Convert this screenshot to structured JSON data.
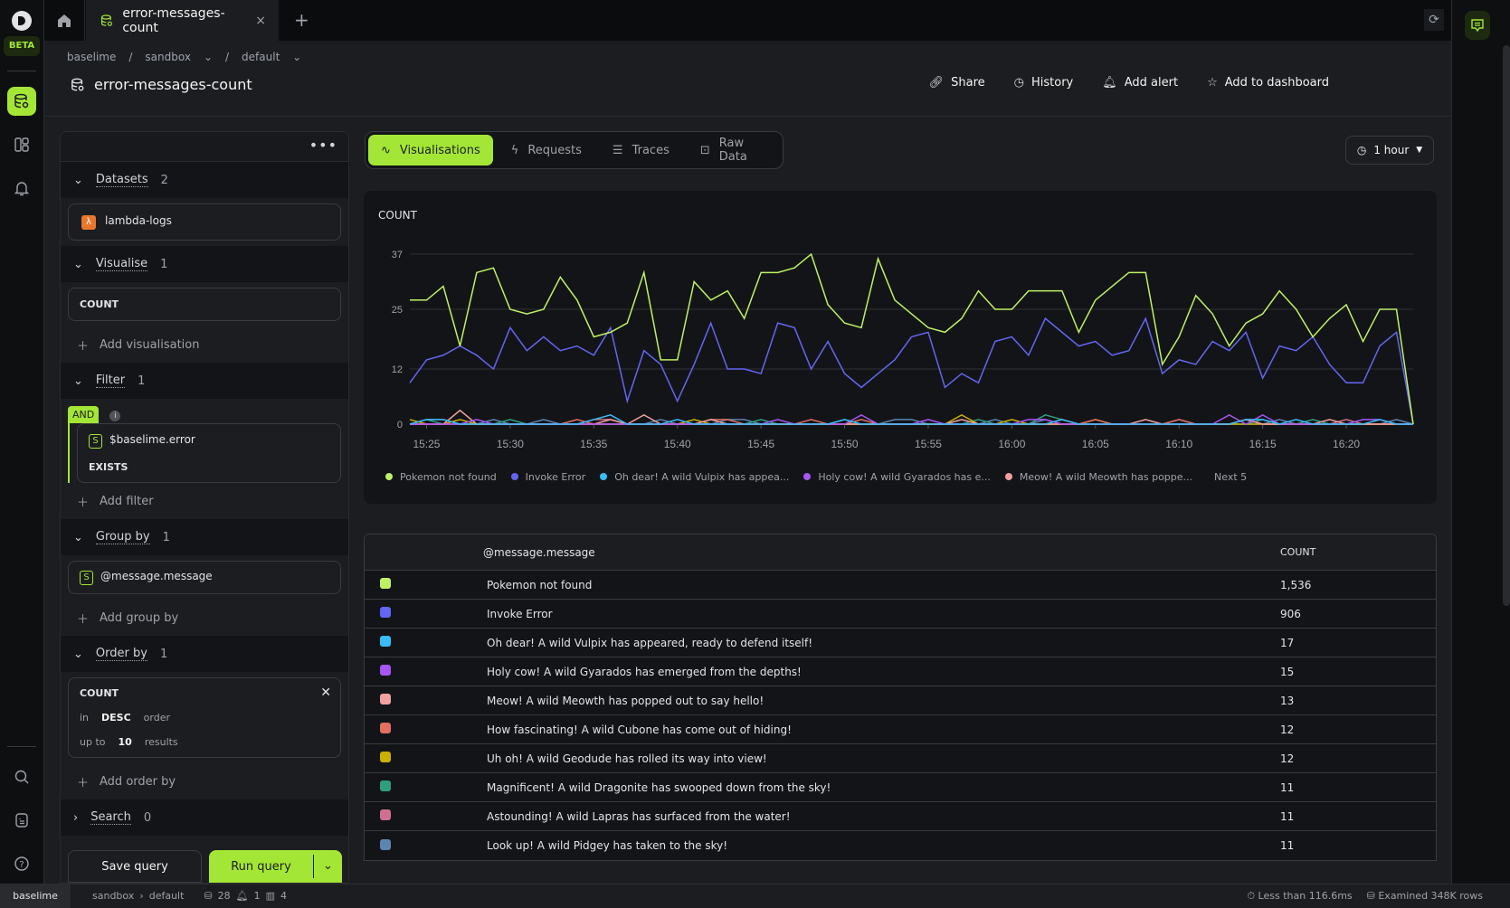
{
  "nav": {
    "beta_label": "BETA",
    "items": [
      {
        "name": "query-icon",
        "active": true
      },
      {
        "name": "dashboards-icon",
        "active": false
      },
      {
        "name": "alerts-icon",
        "active": false
      }
    ],
    "bottom_items": [
      "search-icon",
      "docs-icon",
      "help-icon"
    ]
  },
  "tabs": {
    "active_tab": "error-messages-count",
    "close_glyph": "×",
    "add_glyph": "+"
  },
  "breadcrumb": {
    "org": "baselime",
    "env": "sandbox",
    "service": "default",
    "sep": "/"
  },
  "page": {
    "title": "error-messages-count",
    "actions": {
      "share": "Share",
      "history": "History",
      "add_alert": "Add alert",
      "add_to_dashboard": "Add to dashboard"
    }
  },
  "query": {
    "datasets": {
      "label": "Datasets",
      "count": "2",
      "items": [
        "lambda-logs"
      ]
    },
    "visualise": {
      "label": "Visualise",
      "count": "1",
      "items": [
        "COUNT"
      ],
      "add": "Add visualisation"
    },
    "filter": {
      "label": "Filter",
      "count": "1",
      "operator": "AND",
      "items": [
        {
          "key": "$baselime.error",
          "op": "EXISTS"
        }
      ],
      "add": "Add filter"
    },
    "group_by": {
      "label": "Group by",
      "count": "1",
      "items": [
        "@message.message"
      ],
      "add": "Add group by"
    },
    "order_by": {
      "label": "Order by",
      "count": "1",
      "field": "COUNT",
      "in": "in",
      "direction": "DESC",
      "order": "order",
      "up_to": "up to",
      "limit": "10",
      "results": "results",
      "add": "Add order by"
    },
    "search": {
      "label": "Search",
      "count": "0"
    },
    "save": "Save query",
    "run": "Run query"
  },
  "view_tabs": {
    "visualisations": "Visualisations",
    "requests": "Requests",
    "traces": "Traces",
    "raw_data": "Raw Data"
  },
  "time_range": "1 hour",
  "chart_data": {
    "type": "line",
    "title": "COUNT",
    "xlabel": "",
    "ylabel": "",
    "ylim": [
      0,
      37
    ],
    "yticks": [
      0,
      12,
      25,
      37
    ],
    "xticks": [
      "15:25",
      "15:30",
      "15:35",
      "15:40",
      "15:45",
      "15:50",
      "15:55",
      "16:00",
      "16:05",
      "16:10",
      "16:15",
      "16:20"
    ],
    "x_start": "15:24",
    "x_step_minutes": 1,
    "grid": true,
    "legend_position": "bottom-left",
    "legend_more": "Next 5",
    "series": [
      {
        "name": "Pokemon not found",
        "legend": "Pokemon not found",
        "color": "#bef264",
        "values": [
          27,
          27,
          30,
          17,
          33,
          34,
          25,
          24,
          25,
          32,
          27,
          19,
          20,
          22,
          33,
          14,
          14,
          31,
          27,
          29,
          23,
          33,
          33,
          34,
          37,
          26,
          22,
          21,
          36,
          27,
          24,
          21,
          20,
          23,
          29,
          25,
          25,
          29,
          29,
          29,
          20,
          27,
          30,
          33,
          33,
          13,
          19,
          28,
          24,
          17,
          22,
          24,
          29,
          25,
          19,
          23,
          26,
          18,
          25,
          25,
          0
        ]
      },
      {
        "name": "Invoke Error",
        "legend": "Invoke Error",
        "color": "#6366f1",
        "values": [
          9,
          14,
          15,
          17,
          15,
          12,
          21,
          16,
          19,
          16,
          17,
          15,
          21,
          5,
          16,
          13,
          5,
          13,
          22,
          12,
          12,
          11,
          22,
          21,
          12,
          18,
          11,
          8,
          11,
          14,
          19,
          20,
          8,
          11,
          9,
          18,
          19,
          15,
          23,
          20,
          17,
          18,
          15,
          16,
          23,
          11,
          14,
          13,
          18,
          16,
          20,
          10,
          17,
          16,
          19,
          13,
          9,
          9,
          17,
          20,
          0
        ]
      },
      {
        "name": "Oh dear! A wild Vulpix has appeared, ready to defend itself!",
        "legend": "Oh dear! A wild Vulpix has appea...",
        "color": "#38bdf8",
        "values": [
          0,
          1,
          1,
          0,
          0,
          0,
          0,
          0,
          0,
          0,
          0,
          1,
          2,
          0,
          0,
          0,
          1,
          0,
          0,
          0,
          0,
          0,
          0,
          0,
          0,
          0,
          1,
          0,
          0,
          0,
          0,
          0,
          0,
          0,
          0,
          0,
          0,
          0,
          0,
          1,
          0,
          0,
          0,
          0,
          0,
          0,
          0,
          0,
          0,
          0,
          1,
          1,
          0,
          1,
          0,
          0,
          0,
          0,
          1,
          0,
          0
        ]
      },
      {
        "name": "Holy cow! A wild Gyarados has emerged from the depths!",
        "legend": "Holy cow! A wild Gyarados has e...",
        "color": "#a855f7",
        "values": [
          0,
          0,
          0,
          0,
          1,
          0,
          0,
          0,
          0,
          0,
          0,
          0,
          0,
          0,
          0,
          0,
          0,
          0,
          0,
          0,
          0,
          0,
          1,
          0,
          0,
          0,
          0,
          2,
          0,
          0,
          0,
          1,
          0,
          0,
          0,
          0,
          0,
          1,
          1,
          0,
          0,
          0,
          0,
          0,
          0,
          0,
          0,
          0,
          0,
          2,
          0,
          2,
          0,
          0,
          0,
          0,
          0,
          1,
          1,
          0,
          0
        ]
      },
      {
        "name": "Meow! A wild Meowth has popped out to say hello!",
        "legend": "Meow! A wild Meowth has poppe...",
        "color": "#f0a0a0",
        "values": [
          0,
          0,
          0,
          3,
          0,
          0,
          0,
          0,
          0,
          0,
          0,
          0,
          1,
          0,
          2,
          0,
          0,
          0,
          1,
          0,
          0,
          0,
          0,
          0,
          0,
          0,
          0,
          0,
          0,
          0,
          0,
          0,
          0,
          1,
          0,
          0,
          0,
          0,
          0,
          0,
          0,
          0,
          0,
          0,
          1,
          0,
          0,
          0,
          0,
          0,
          1,
          0,
          0,
          0,
          0,
          1,
          0,
          0,
          0,
          0,
          0
        ]
      },
      {
        "name": "How fascinating! A wild Cubone has come out of hiding!",
        "legend": "",
        "color": "#e07060",
        "values": [
          0,
          0,
          0,
          0,
          0,
          0,
          0,
          0,
          0,
          0,
          1,
          0,
          0,
          0,
          0,
          0,
          0,
          0,
          1,
          1,
          0,
          0,
          0,
          0,
          1,
          0,
          0,
          1,
          0,
          0,
          0,
          0,
          0,
          0,
          0,
          0,
          0,
          0,
          0,
          1,
          0,
          1,
          0,
          0,
          0,
          0,
          1,
          0,
          0,
          0,
          1,
          0,
          0,
          0,
          0,
          0,
          0,
          0,
          0,
          0,
          0
        ]
      },
      {
        "name": "Uh oh! A wild Geodude has rolled its way into view!",
        "legend": "",
        "color": "#cab000",
        "values": [
          1,
          0,
          0,
          1,
          0,
          0,
          0,
          0,
          0,
          0,
          0,
          0,
          0,
          0,
          0,
          0,
          0,
          1,
          0,
          0,
          0,
          0,
          0,
          0,
          0,
          0,
          0,
          0,
          0,
          0,
          0,
          0,
          0,
          2,
          0,
          0,
          1,
          0,
          0,
          0,
          0,
          1,
          0,
          0,
          0,
          0,
          0,
          0,
          0,
          0,
          0,
          0,
          0,
          0,
          0,
          0,
          0,
          0,
          0,
          0,
          0
        ]
      },
      {
        "name": "Magnificent! A wild Dragonite has swooped down from the sky!",
        "legend": "",
        "color": "#2f9e7e",
        "values": [
          0,
          1,
          0,
          0,
          0,
          0,
          1,
          0,
          0,
          0,
          0,
          0,
          0,
          0,
          0,
          0,
          0,
          0,
          0,
          0,
          0,
          1,
          0,
          0,
          0,
          0,
          0,
          0,
          0,
          0,
          0,
          0,
          0,
          0,
          1,
          0,
          0,
          0,
          2,
          1,
          0,
          0,
          0,
          0,
          0,
          0,
          0,
          0,
          0,
          0,
          0,
          1,
          0,
          0,
          1,
          0,
          0,
          0,
          0,
          0,
          0
        ]
      },
      {
        "name": "Astounding! A wild Lapras has surfaced from the water!",
        "legend": "",
        "color": "#d07090",
        "values": [
          0,
          0,
          0,
          0,
          0,
          0,
          0,
          0,
          0,
          0,
          0,
          1,
          1,
          0,
          0,
          0,
          0,
          0,
          0,
          0,
          0,
          0,
          0,
          0,
          0,
          0,
          0,
          0,
          0,
          0,
          0,
          0,
          0,
          0,
          0,
          0,
          0,
          0,
          0,
          0,
          0,
          0,
          0,
          0,
          0,
          0,
          0,
          0,
          0,
          0,
          1,
          0,
          0,
          0,
          0,
          0,
          1,
          0,
          0,
          0,
          0
        ]
      },
      {
        "name": "Look up! A wild Pidgey has taken to the sky!",
        "legend": "",
        "color": "#5b84b1",
        "values": [
          0,
          1,
          1,
          0,
          0,
          1,
          0,
          0,
          1,
          0,
          0,
          0,
          0,
          0,
          0,
          1,
          0,
          0,
          0,
          1,
          1,
          0,
          0,
          0,
          0,
          0,
          1,
          0,
          0,
          1,
          1,
          0,
          0,
          0,
          0,
          1,
          0,
          0,
          1,
          0,
          0,
          0,
          0,
          0,
          0,
          0,
          1,
          0,
          0,
          0,
          0,
          0,
          1,
          0,
          0,
          0,
          0,
          0,
          0,
          1,
          0
        ]
      }
    ]
  },
  "table": {
    "headers": [
      "",
      "@message.message",
      "COUNT"
    ],
    "rows": [
      {
        "color": "#bef264",
        "message": "Pokemon not found",
        "count": "1,536"
      },
      {
        "color": "#6366f1",
        "message": "Invoke Error",
        "count": "906"
      },
      {
        "color": "#38bdf8",
        "message": "Oh dear! A wild Vulpix has appeared, ready to defend itself!",
        "count": "17"
      },
      {
        "color": "#a855f7",
        "message": "Holy cow! A wild Gyarados has emerged from the depths!",
        "count": "15"
      },
      {
        "color": "#f0a0a0",
        "message": "Meow! A wild Meowth has popped out to say hello!",
        "count": "13"
      },
      {
        "color": "#e07060",
        "message": "How fascinating! A wild Cubone has come out of hiding!",
        "count": "12"
      },
      {
        "color": "#cab000",
        "message": "Uh oh! A wild Geodude has rolled its way into view!",
        "count": "12"
      },
      {
        "color": "#2f9e7e",
        "message": "Magnificent! A wild Dragonite has swooped down from the sky!",
        "count": "11"
      },
      {
        "color": "#d07090",
        "message": "Astounding! A wild Lapras has surfaced from the water!",
        "count": "11"
      },
      {
        "color": "#5b84b1",
        "message": "Look up! A wild Pidgey has taken to the sky!",
        "count": "11"
      }
    ]
  },
  "statusbar": {
    "org": "baselime",
    "env": "sandbox",
    "sep": "›",
    "service": "default",
    "queries_count": "28",
    "alerts_count": "1",
    "dashboards_count": "4",
    "duration": "Less than 116.6ms",
    "examined": "Examined 348K rows"
  },
  "colors": {
    "accent": "#a3e635"
  }
}
